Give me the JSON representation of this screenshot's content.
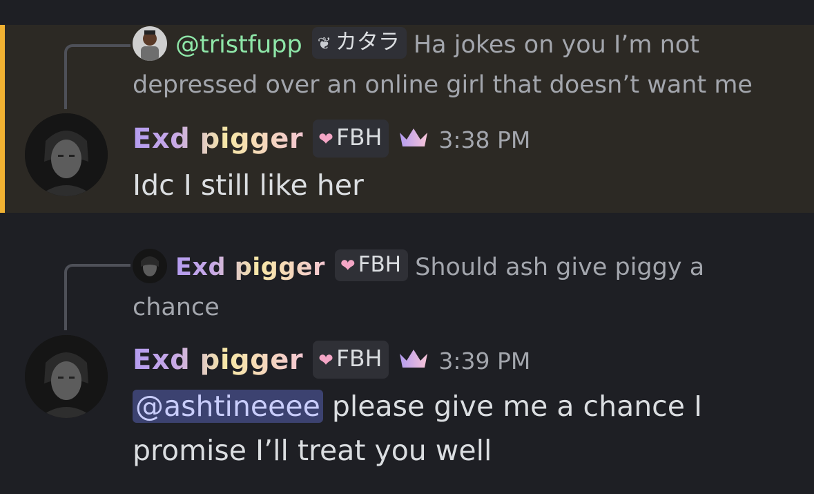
{
  "colors": {
    "background": "#1e1f24",
    "highlight_background": "#2c2924",
    "highlight_bar": "#f0b132",
    "mention_background": "#3c4270",
    "mention_text": "#c9cdfb",
    "reply_name_green": "#8ee6a8"
  },
  "messages": [
    {
      "highlighted": true,
      "reply": {
        "author": "@tristfupp",
        "tag": {
          "icon": "leaf-icon",
          "label": "カタラ"
        },
        "text": "Ha jokes on you I’m not depressed over an online girl that doesn’t want me"
      },
      "author": "Exd pigger",
      "tag": {
        "icon": "heart-icon",
        "label": "FBH"
      },
      "badge_icon": "crown-icon",
      "time": "3:38 PM",
      "content": "Idc I still like her"
    },
    {
      "highlighted": false,
      "reply": {
        "author": "Exd pigger",
        "tag": {
          "icon": "heart-icon",
          "label": "FBH"
        },
        "text": "Should ash give piggy a chance"
      },
      "author": "Exd pigger",
      "tag": {
        "icon": "heart-icon",
        "label": "FBH"
      },
      "badge_icon": "crown-icon",
      "time": "3:39 PM",
      "mention": "@ashtineeee",
      "content": "please give me a chance I promise I’ll treat you well"
    }
  ]
}
